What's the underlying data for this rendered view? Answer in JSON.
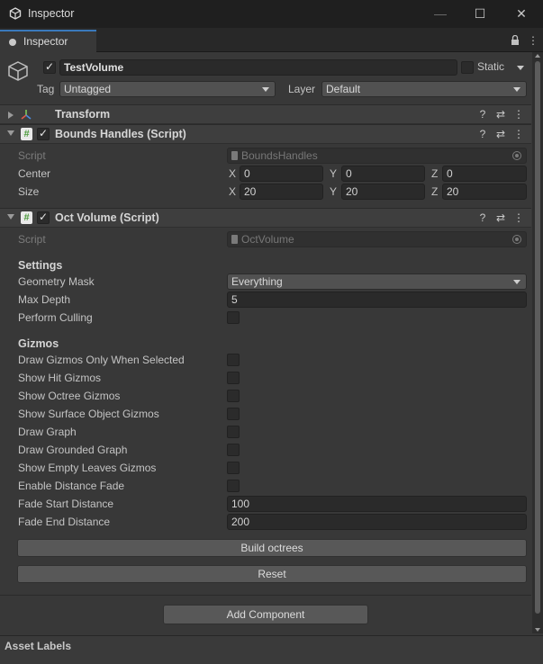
{
  "window": {
    "title": "Inspector",
    "minimize": "—",
    "maximize": "☐",
    "close": "✕"
  },
  "tab": {
    "label": "Inspector",
    "lock": "🔒",
    "menu": "⋮"
  },
  "header": {
    "object_name": "TestVolume",
    "static_label": "Static",
    "tag_label": "Tag",
    "tag_value": "Untagged",
    "layer_label": "Layer",
    "layer_value": "Default"
  },
  "transform": {
    "title": "Transform"
  },
  "bounds_handles": {
    "title": "Bounds Handles (Script)",
    "script_label": "Script",
    "script_value": "BoundsHandles",
    "center_label": "Center",
    "size_label": "Size",
    "center": {
      "x": "0",
      "y": "0",
      "z": "0"
    },
    "size": {
      "x": "20",
      "y": "20",
      "z": "20"
    },
    "axis_x": "X",
    "axis_y": "Y",
    "axis_z": "Z"
  },
  "oct_volume": {
    "title": "Oct Volume (Script)",
    "script_label": "Script",
    "script_value": "OctVolume",
    "settings_header": "Settings",
    "geometry_mask_label": "Geometry Mask",
    "geometry_mask_value": "Everything",
    "max_depth_label": "Max Depth",
    "max_depth_value": "5",
    "perform_culling_label": "Perform Culling",
    "gizmos_header": "Gizmos",
    "gizmo_options": [
      "Draw Gizmos Only When Selected",
      "Show Hit Gizmos",
      "Show Octree Gizmos",
      "Show Surface Object Gizmos",
      "Draw Graph",
      "Draw Grounded Graph",
      "Show Empty Leaves Gizmos",
      "Enable Distance Fade"
    ],
    "fade_start_label": "Fade Start Distance",
    "fade_start_value": "100",
    "fade_end_label": "Fade End Distance",
    "fade_end_value": "200",
    "build_button": "Build octrees",
    "reset_button": "Reset"
  },
  "add_component": "Add Component",
  "asset_labels": "Asset Labels",
  "icons": {
    "help": "?",
    "settings": "⇄",
    "more": "⋮"
  }
}
